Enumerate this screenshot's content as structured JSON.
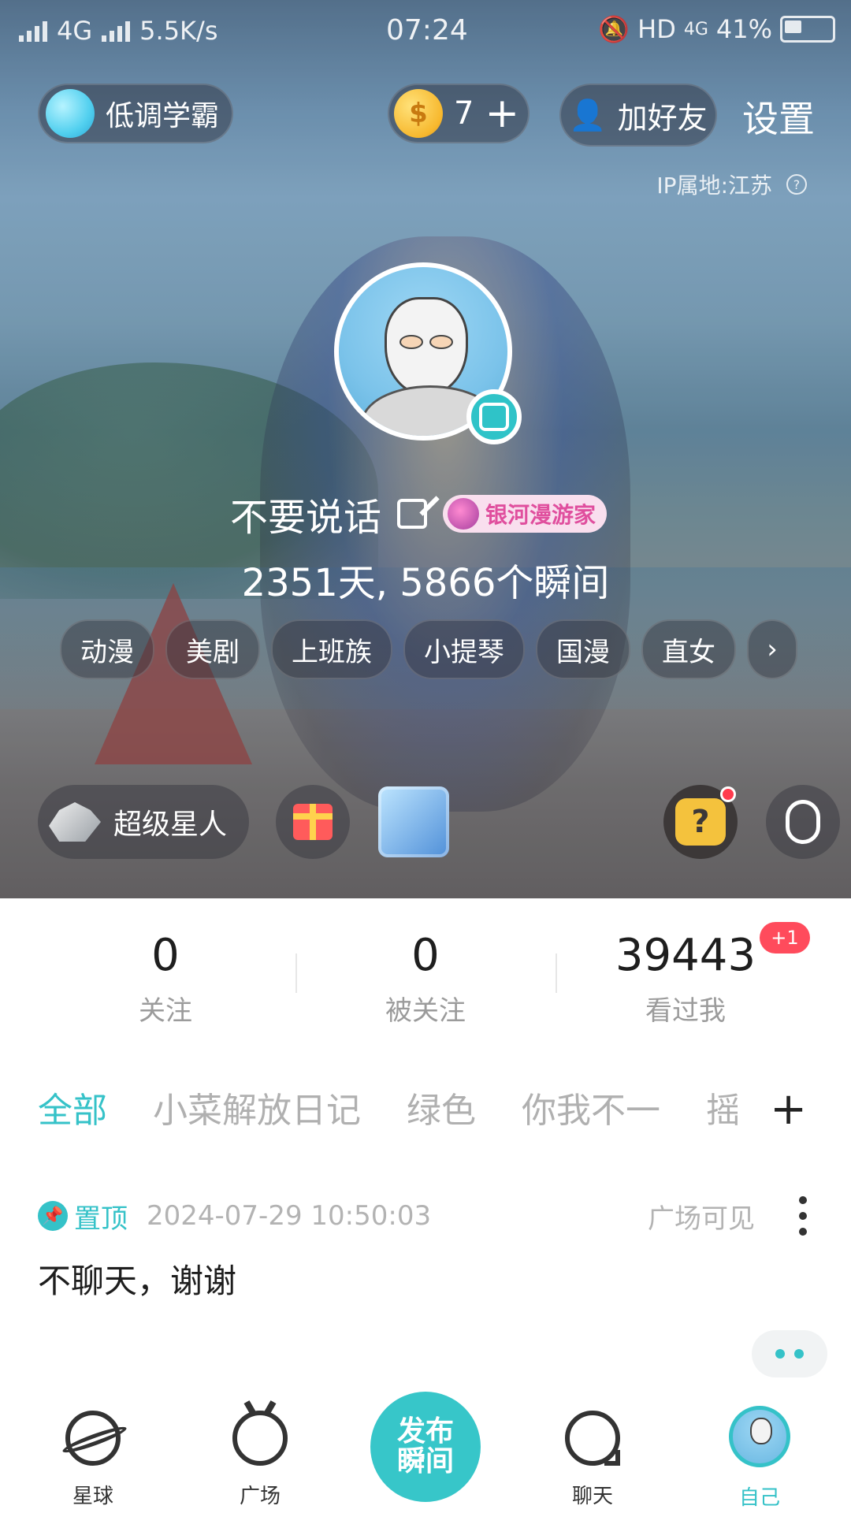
{
  "status_bar": {
    "network_left": "4G",
    "speed": "5.5K/s",
    "time": "07:24",
    "hd": "HD",
    "network_right": "4G",
    "battery": "41%",
    "battery_level": 0.41
  },
  "header": {
    "profile_tag": "低调学霸",
    "coins": "7",
    "add_friend": "加好友",
    "settings": "设置",
    "ip_location": "IP属地:江苏"
  },
  "profile": {
    "name": "不要说话",
    "title_badge": "银河漫游家",
    "stats_line": "2351天, 5866个瞬间",
    "tags": [
      "动漫",
      "美剧",
      "上班族",
      "小提琴",
      "国漫",
      "直女"
    ]
  },
  "badges": {
    "superstar": "超级星人"
  },
  "counts": {
    "following": "0",
    "following_label": "关注",
    "followers": "0",
    "followers_label": "被关注",
    "visitors": "39443",
    "visitors_label": "看过我",
    "visitors_badge": "+1"
  },
  "category_tabs": [
    "全部",
    "小菜解放日记",
    "绿色",
    "你我不一",
    "摇"
  ],
  "post": {
    "pinned": "置顶",
    "timestamp": "2024-07-29 10:50:03",
    "visibility": "广场可见",
    "text": "不聊天，谢谢"
  },
  "nav": {
    "planet": "星球",
    "square": "广场",
    "publish_line1": "发布",
    "publish_line2": "瞬间",
    "chat": "聊天",
    "self": "自己"
  },
  "colors": {
    "accent": "#35c2c8",
    "badge_red": "#ff4b5c",
    "title_badge_pink": "#e04f9e"
  }
}
